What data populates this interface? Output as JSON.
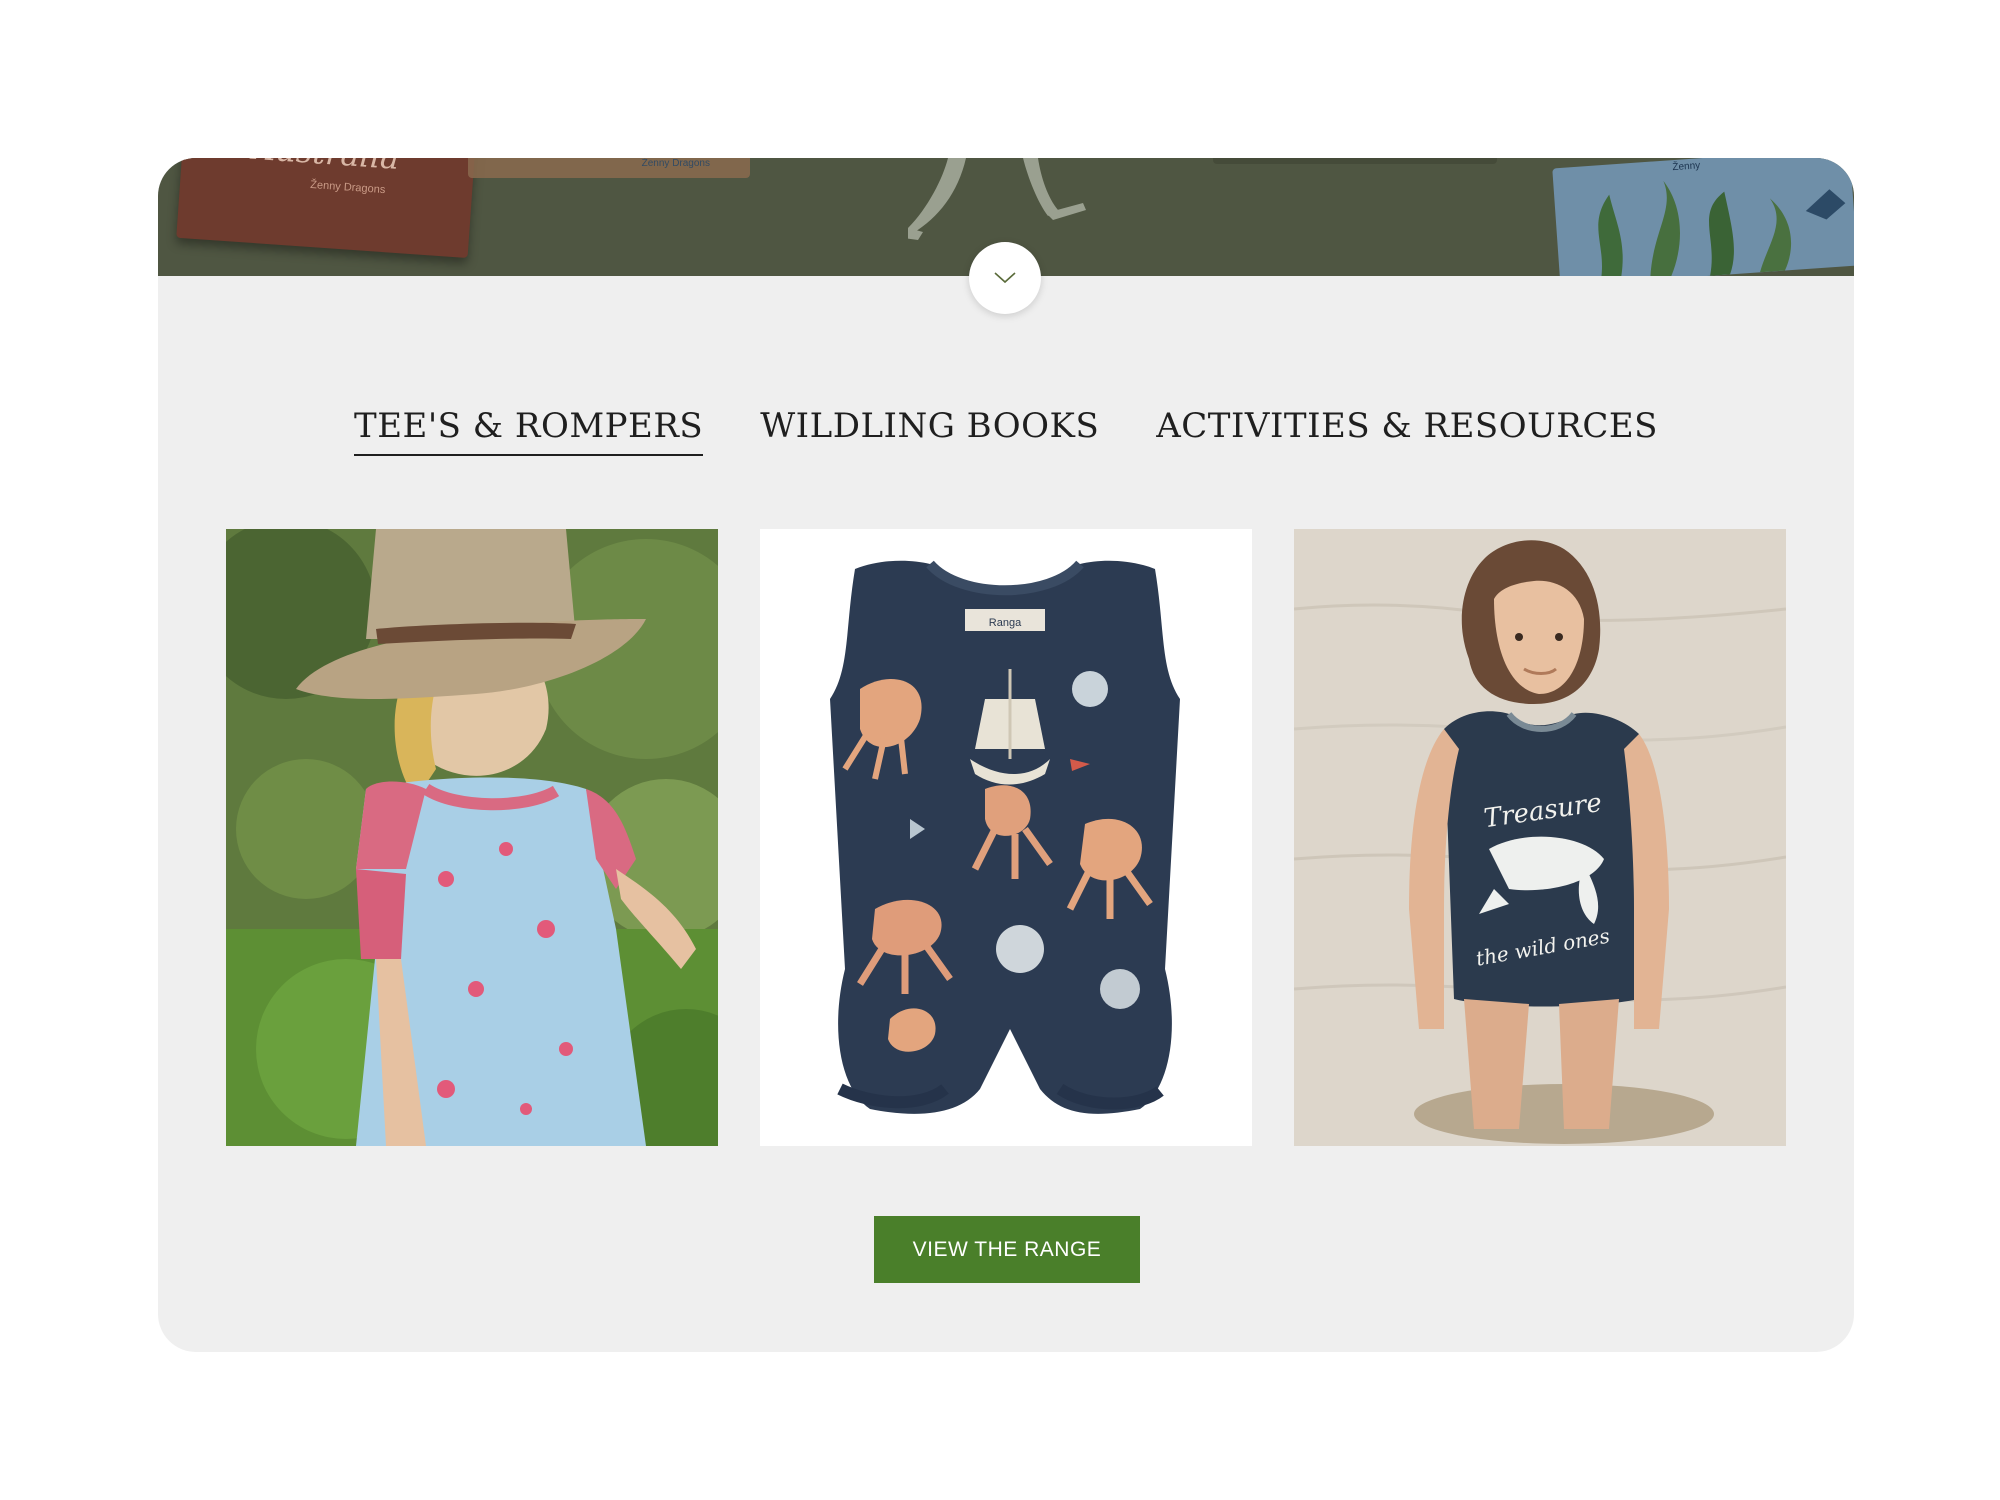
{
  "hero": {
    "books": [
      {
        "title": "Australia",
        "author": "Ženny Dragons"
      },
      {
        "author": "Ženny Dragons"
      },
      {
        "author": "Ženny"
      }
    ]
  },
  "tabs": [
    {
      "label": "TEE'S & ROMPERS",
      "active": true
    },
    {
      "label": "WILDLING BOOKS",
      "active": false
    },
    {
      "label": "ACTIVITIES & RESOURCES",
      "active": false
    }
  ],
  "products": [
    {
      "image": "girl-in-hat-wearing-floral-tee"
    },
    {
      "image": "navy-ocean-print-romper",
      "label_text": "Ranga"
    },
    {
      "image": "child-in-water-wearing-navy-singlet",
      "print_text_top": "Treasure",
      "print_text_bottom": "the wild ones"
    }
  ],
  "cta": {
    "label": "VIEW THE RANGE"
  },
  "colors": {
    "hero_bg": "#4f5642",
    "card_bg": "#efefef",
    "cta_bg": "#4a7f2a",
    "romper_navy": "#2c3b52",
    "singlet_navy": "#2b3a4d"
  }
}
